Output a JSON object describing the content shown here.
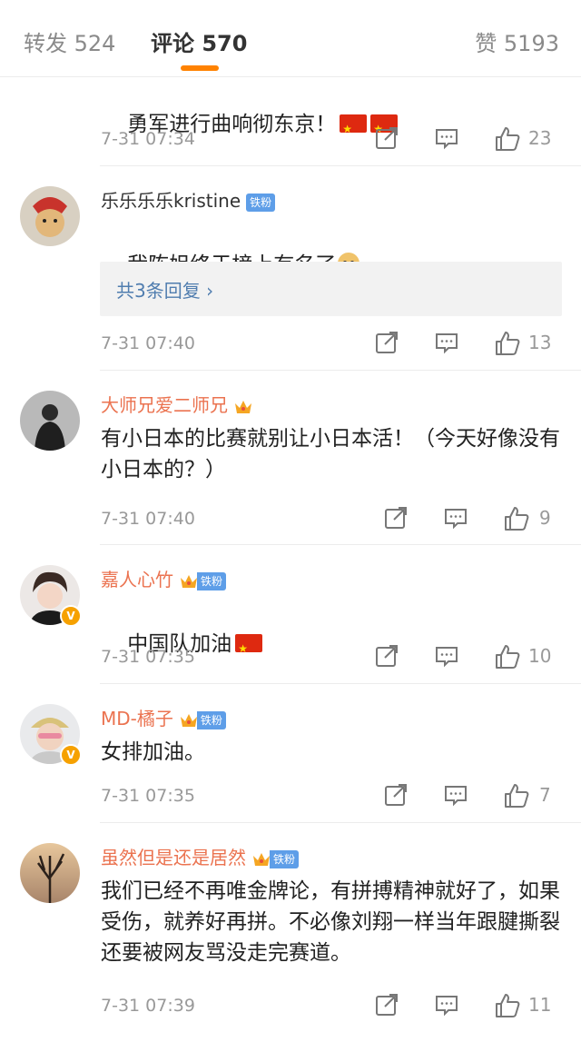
{
  "tabs": {
    "repost": "转发 524",
    "comment": "评论 570",
    "like": "赞 5193",
    "accent_color": "#ff8200"
  },
  "badges": {
    "fan": "铁粉"
  },
  "comments": [
    {
      "username": "",
      "text": "勇军进行曲响彻东京！",
      "emoji": "flag-china x2",
      "time": "7-31 07:34",
      "likes": "23"
    },
    {
      "username": "乐乐乐乐kristine",
      "text": "我陈姐终于榜上有名了",
      "emoji": "doge",
      "replies": "共3条回复 ›",
      "time": "7-31 07:40",
      "likes": "13"
    },
    {
      "username": "大师兄爱二师兄",
      "text": "有小日本的比赛就别让小日本活！（今天好像没有小日本的？）",
      "time": "7-31 07:40",
      "likes": "9"
    },
    {
      "username": "嘉人心竹",
      "text": "中国队加油",
      "emoji": "flag-china",
      "time": "7-31 07:35",
      "likes": "10"
    },
    {
      "username": "MD-橘子",
      "text": "女排加油。",
      "time": "7-31 07:35",
      "likes": "7"
    },
    {
      "username": "虽然但是还是居然",
      "text": "我们已经不再唯金牌论，有拼搏精神就好了，如果受伤，就养好再拼。不必像刘翔一样当年跟腱撕裂还要被网友骂没走完赛道。",
      "time": "7-31 07:39",
      "likes": "11"
    }
  ]
}
